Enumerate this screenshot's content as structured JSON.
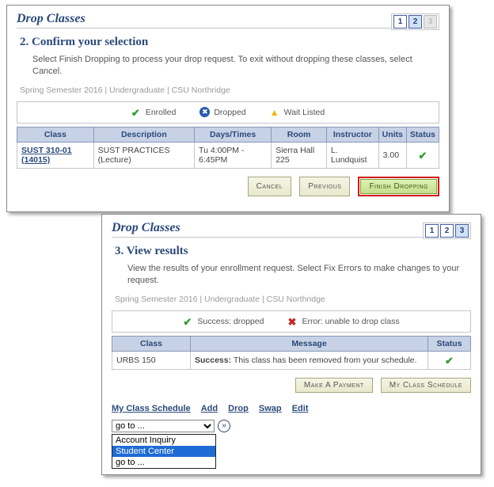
{
  "panel1": {
    "title": "Drop Classes",
    "steps": [
      "1",
      "2",
      "3"
    ],
    "active_step_index": 1,
    "disabled_step_index": 2,
    "subtitle": "2.  Confirm your selection",
    "body": "Select Finish Dropping to process your drop request. To exit without dropping these classes, select Cancel.",
    "term_line": "Spring Semester 2016 | Undergraduate | CSU Northridge",
    "legend": {
      "enrolled": "Enrolled",
      "dropped": "Dropped",
      "waitlist": "Wait Listed"
    },
    "columns": [
      "Class",
      "Description",
      "Days/Times",
      "Room",
      "Instructor",
      "Units",
      "Status"
    ],
    "rows": [
      {
        "class_link": "SUST 310-01 (14015)",
        "description": "SUST PRACTICES (Lecture)",
        "days_times": "Tu 4:00PM - 6:45PM",
        "room": "Sierra Hall 225",
        "instructor": "L. Lundquist",
        "units": "3.00"
      }
    ],
    "buttons": {
      "cancel": "Cancel",
      "previous": "Previous",
      "finish": "Finish Dropping"
    }
  },
  "panel2": {
    "title": "Drop Classes",
    "steps": [
      "1",
      "2",
      "3"
    ],
    "active_step_index": 2,
    "subtitle": "3.  View results",
    "body": "View the results of your enrollment request.  Select Fix Errors to make changes to your request.",
    "term_line": "Spring Semester 2016 | Undergraduate | CSU Northridge",
    "legend": {
      "success": "Success: dropped",
      "error": "Error: unable to drop class"
    },
    "columns": [
      "Class",
      "Message",
      "Status"
    ],
    "rows": [
      {
        "class": "URBS  150",
        "message_strong": "Success:",
        "message_rest": "This class has been removed from your schedule."
      }
    ],
    "buttons": {
      "make_payment": "Make A Payment",
      "my_schedule": "My Class Schedule"
    },
    "links": {
      "my_schedule": "My Class Schedule",
      "add": "Add",
      "drop": "Drop",
      "swap": "Swap",
      "edit": "Edit"
    },
    "goto": {
      "selected": "go to ...",
      "options": [
        "Account Inquiry",
        "Student Center",
        "go to ..."
      ],
      "highlight_index": 1
    }
  }
}
